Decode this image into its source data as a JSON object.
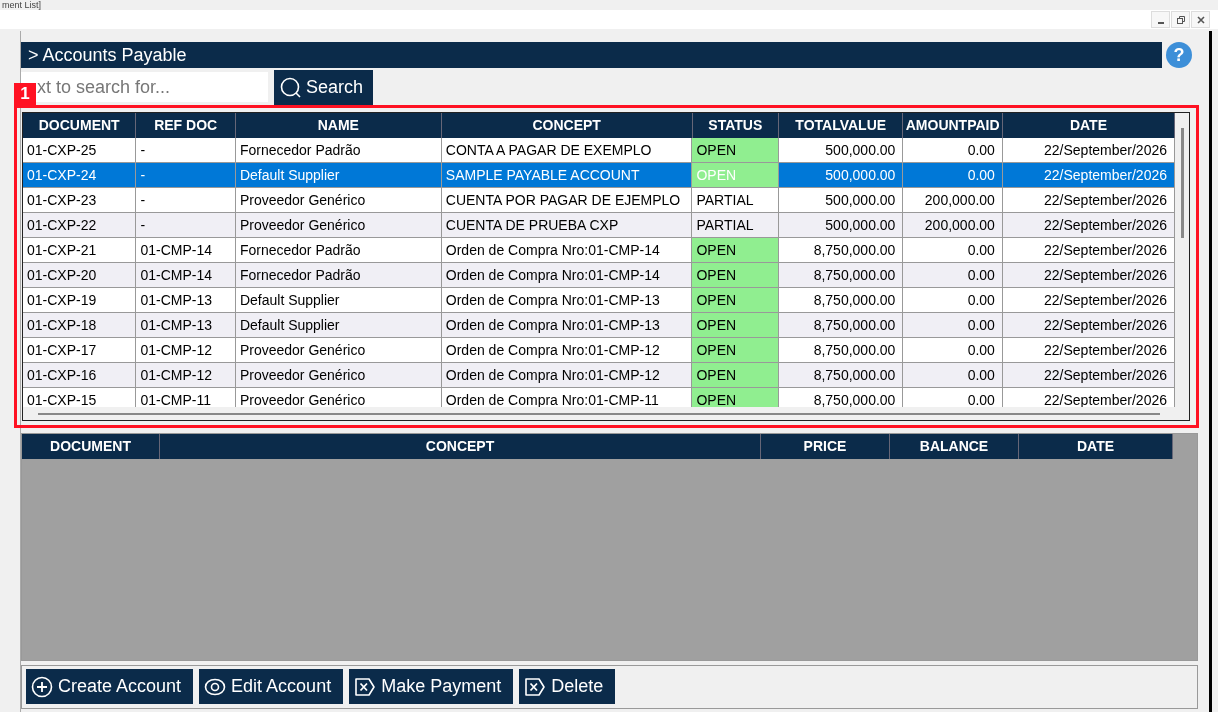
{
  "window": {
    "title": "ment List]"
  },
  "header": {
    "title": "> Accounts Payable",
    "help": "?"
  },
  "search": {
    "placeholder": "xt to search for...",
    "button": "Search"
  },
  "annotation": {
    "label": "1"
  },
  "table": {
    "columns": [
      "DOCUMENT",
      "REF DOC",
      "NAME",
      "CONCEPT",
      "STATUS",
      "TOTALVALUE",
      "AMOUNTPAID",
      "DATE"
    ],
    "rows": [
      {
        "cells": [
          "01-CXP-25",
          "-",
          "Fornecedor Padrão",
          "CONTA A PAGAR DE EXEMPLO",
          "OPEN",
          "500,000.00",
          "0.00",
          "22/September/2026"
        ],
        "color": "#90ee90",
        "selected": false
      },
      {
        "cells": [
          "01-CXP-24",
          "-",
          "Default Supplier",
          "SAMPLE PAYABLE ACCOUNT",
          "OPEN",
          "500,000.00",
          "0.00",
          "22/September/2026"
        ],
        "color": "#90ee90",
        "selected": true
      },
      {
        "cells": [
          "01-CXP-23",
          "-",
          "Proveedor Genérico",
          "CUENTA POR PAGAR DE EJEMPLO",
          "PARTIAL",
          "500,000.00",
          "200,000.00",
          "22/September/2026"
        ],
        "selected": false
      },
      {
        "cells": [
          "01-CXP-22",
          "-",
          "Proveedor Genérico",
          "CUENTA DE PRUEBA CXP",
          "PARTIAL",
          "500,000.00",
          "200,000.00",
          "22/September/2026"
        ],
        "selected": false
      },
      {
        "cells": [
          "01-CXP-21",
          "01-CMP-14",
          "Fornecedor Padrão",
          "Orden de Compra Nro:01-CMP-14",
          "OPEN",
          "8,750,000.00",
          "0.00",
          "22/September/2026"
        ],
        "color": "#90ee90",
        "selected": false
      },
      {
        "cells": [
          "01-CXP-20",
          "01-CMP-14",
          "Fornecedor Padrão",
          "Orden de Compra Nro:01-CMP-14",
          "OPEN",
          "8,750,000.00",
          "0.00",
          "22/September/2026"
        ],
        "color": "#90ee90",
        "selected": false
      },
      {
        "cells": [
          "01-CXP-19",
          "01-CMP-13",
          "Default Supplier",
          "Orden de Compra Nro:01-CMP-13",
          "OPEN",
          "8,750,000.00",
          "0.00",
          "22/September/2026"
        ],
        "color": "#90ee90",
        "selected": false
      },
      {
        "cells": [
          "01-CXP-18",
          "01-CMP-13",
          "Default Supplier",
          "Orden de Compra Nro:01-CMP-13",
          "OPEN",
          "8,750,000.00",
          "0.00",
          "22/September/2026"
        ],
        "color": "#90ee90",
        "selected": false
      },
      {
        "cells": [
          "01-CXP-17",
          "01-CMP-12",
          "Proveedor Genérico",
          "Orden de Compra Nro:01-CMP-12",
          "OPEN",
          "8,750,000.00",
          "0.00",
          "22/September/2026"
        ],
        "color": "#90ee90",
        "selected": false
      },
      {
        "cells": [
          "01-CXP-16",
          "01-CMP-12",
          "Proveedor Genérico",
          "Orden de Compra Nro:01-CMP-12",
          "OPEN",
          "8,750,000.00",
          "0.00",
          "22/September/2026"
        ],
        "color": "#90ee90",
        "selected": false
      },
      {
        "cells": [
          "01-CXP-15",
          "01-CMP-11",
          "Proveedor Genérico",
          "Orden de Compra Nro:01-CMP-11",
          "OPEN",
          "8,750,000.00",
          "0.00",
          "22/September/2026"
        ],
        "color": "#90ee90",
        "selected": false
      }
    ]
  },
  "detail_table": {
    "columns": [
      "DOCUMENT",
      "CONCEPT",
      "PRICE",
      "BALANCE",
      "DATE"
    ]
  },
  "buttons": [
    {
      "label": "Create Account",
      "kind": "plus"
    },
    {
      "label": "Edit Account",
      "kind": "eye"
    },
    {
      "label": "Make Payment",
      "kind": "cross"
    },
    {
      "label": "Delete",
      "kind": "cross"
    }
  ]
}
